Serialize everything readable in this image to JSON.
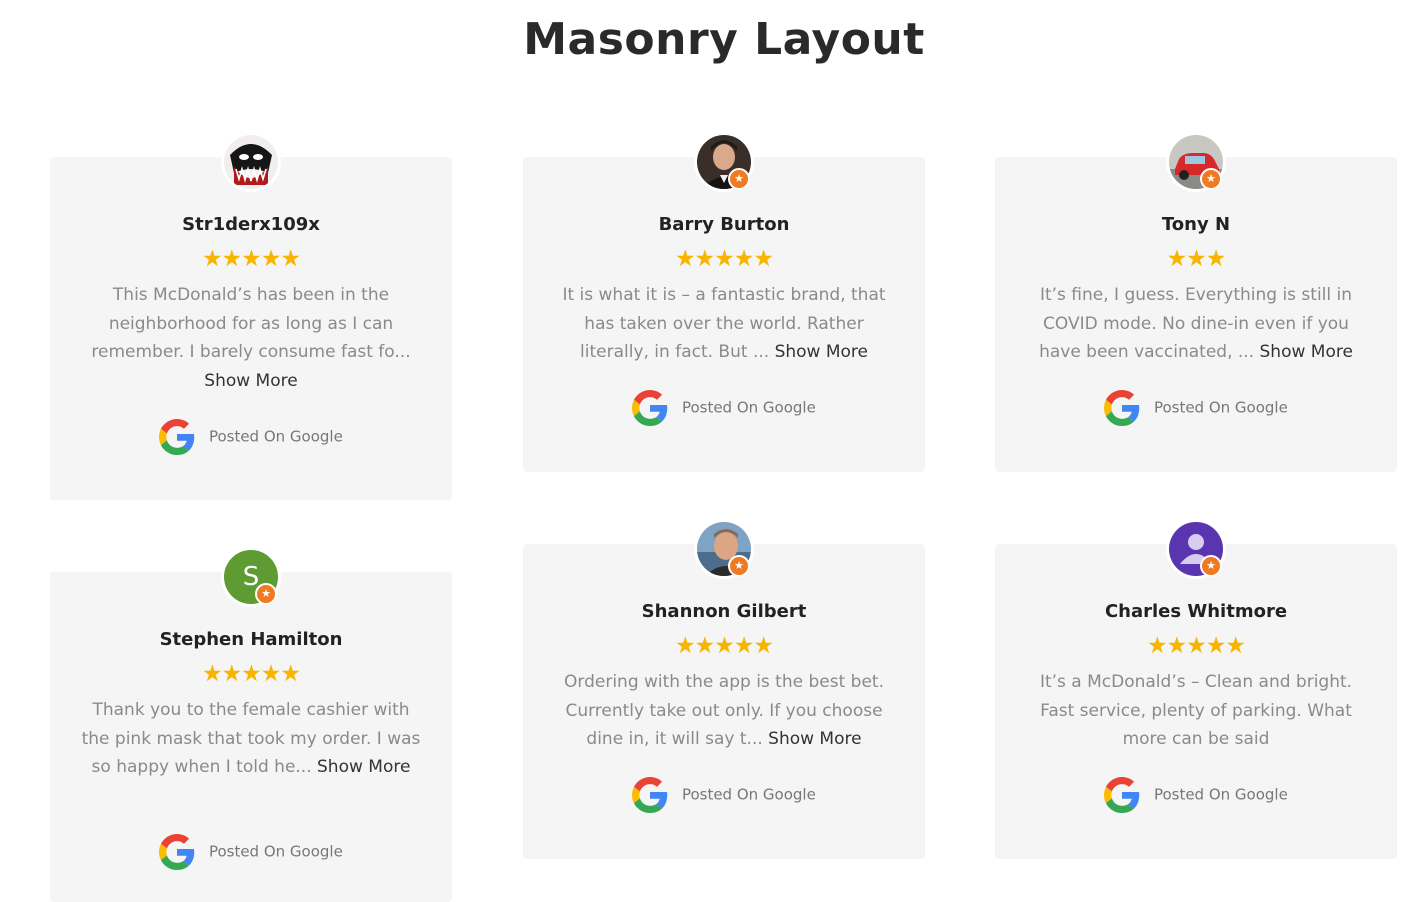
{
  "header": {
    "title": "Masonry Layout"
  },
  "colors": {
    "card_background": "#f5f5f5",
    "star": "#f7b500",
    "badge": "#f07a22"
  },
  "icons": {
    "star": "star-icon",
    "source": "google-logo-icon",
    "badge": "reviewer-badge-icon"
  },
  "reviews": [
    {
      "name": "Str1derx109x",
      "rating": 5,
      "stars": "★★★★★",
      "text": "This McDonald’s has been in the neighborhood for as long as I can remember. I barely consume fast fo...",
      "more": "Show More",
      "source": "Posted On Google"
    },
    {
      "name": "Barry Burton",
      "rating": 5,
      "stars": "★★★★★",
      "text": "It is what it is – a fantastic brand, that has taken over the world. Rather literally, in fact. But ...",
      "more": "Show More",
      "source": "Posted On Google"
    },
    {
      "name": "Tony N",
      "rating": 3,
      "stars": "★★★",
      "text": "It’s fine, I guess. Everything is still in COVID mode. No dine-in even if you have been vaccinated, ...",
      "more": "Show More",
      "source": "Posted On Google"
    },
    {
      "name": "Stephen Hamilton",
      "avatar_letter": "S",
      "rating": 5,
      "stars": "★★★★★",
      "text": "Thank you to the female cashier with the pink mask that took my order. I was so happy when I told he...",
      "more": "Show More",
      "source": "Posted On Google"
    },
    {
      "name": "Shannon Gilbert",
      "rating": 5,
      "stars": "★★★★★",
      "text": "Ordering with the app is the best bet. Currently take out only. If you choose dine in, it will say t...",
      "more": "Show More",
      "source": "Posted On Google"
    },
    {
      "name": "Charles Whitmore",
      "rating": 5,
      "stars": "★★★★★",
      "text": "It’s a McDonald’s – Clean and bright. Fast service, plenty of parking. What more can be said",
      "more": "",
      "source": "Posted On Google"
    }
  ]
}
